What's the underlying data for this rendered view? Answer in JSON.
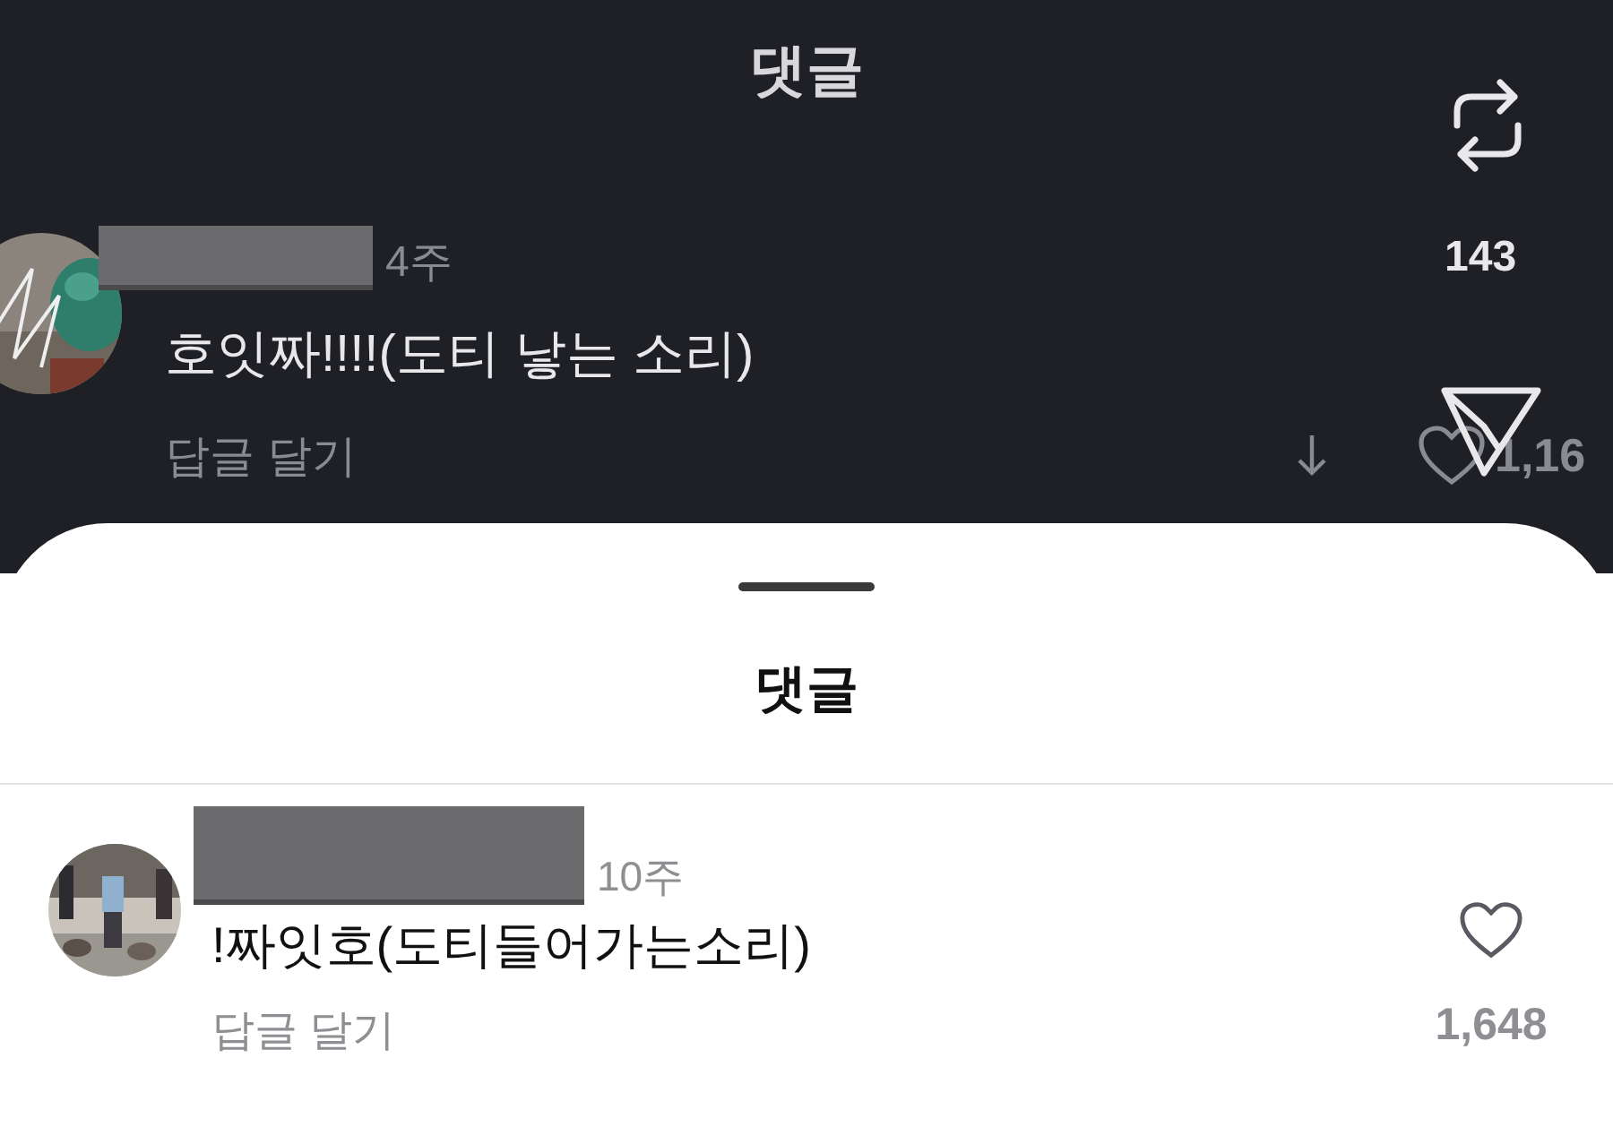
{
  "top": {
    "title": "댓글",
    "repost_count": "143",
    "comment": {
      "redacted": true,
      "time": "4주",
      "text": "호잇짜!!!!(도티 낳는 소리)",
      "reply": "답글 달기",
      "likes": "1,16"
    }
  },
  "sheet": {
    "title": "댓글",
    "comments": [
      {
        "redacted": true,
        "time": "10주",
        "text": "!짜잇호(도티들어가는소리)",
        "reply": "답글 달기",
        "likes": "1,648"
      }
    ]
  }
}
